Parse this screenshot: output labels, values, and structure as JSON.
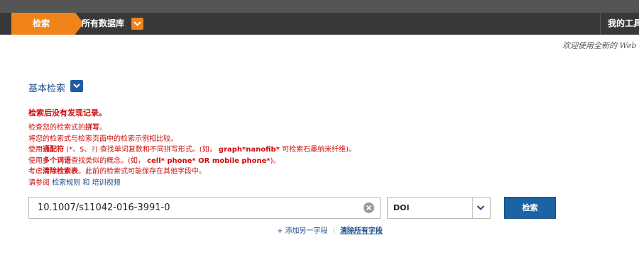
{
  "nav": {
    "active_tab": "检索",
    "databases_label": "所有数据库",
    "tools_label": "我的工具"
  },
  "welcome_text": "欢迎使用全新的 Web of",
  "search": {
    "title": "基本检索",
    "no_results_title": "检索后没有发现记录。",
    "tips": {
      "line1_pre": "检查您的检索式的",
      "line1_bold": "拼写",
      "line1_post": "。",
      "line2": "将您的检索式与检索页面中的检索示例相比较。",
      "line3_pre": "使用",
      "line3_bold": "通配符",
      "line3_mid": " (*、$、?) 查找单词复数和不同拼写形式。(如， ",
      "line3_bold2": "graph*nanofib*",
      "line3_post": " 可检索石墨纳米纤维)。",
      "line4_pre": "使用",
      "line4_bold": "多个词语",
      "line4_mid": "查找类似的概念。(如， ",
      "line4_bold2": "cell* phone* OR mobile phone*",
      "line4_post": ")。",
      "line5_pre": "考虑",
      "line5_bold": "清除检索表",
      "line5_post": "。此前的检索式可能保存在其他字段中。"
    },
    "see_also": {
      "prefix": "请参阅",
      "rules_link": "检索规则",
      "and": "和",
      "video_link": "培训视频"
    },
    "input_value": "10.1007/s11042-016-3991-0",
    "field_select": "DOI",
    "search_button": "检索",
    "add_field": "+ 添加另一字段",
    "clear_all": "清除所有字段"
  },
  "colors": {
    "accent_orange": "#f08418",
    "nav_dark": "#383838",
    "error_red": "#d10c0c",
    "link_blue": "#1d4c8a",
    "button_blue": "#1b63a2"
  }
}
